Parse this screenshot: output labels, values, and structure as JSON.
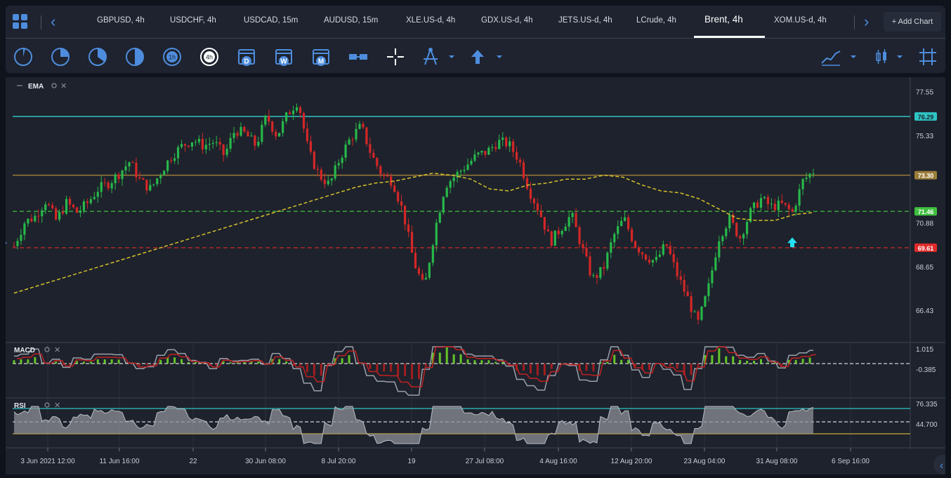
{
  "tabs": [
    {
      "label": "GBPUSD, 4h"
    },
    {
      "label": "USDCHF, 4h"
    },
    {
      "label": "USDCAD, 15m"
    },
    {
      "label": "AUDUSD, 15m"
    },
    {
      "label": "XLE.US-d, 4h"
    },
    {
      "label": "GDX.US-d, 4h"
    },
    {
      "label": "JETS.US-d, 4h"
    },
    {
      "label": "LCrude, 4h"
    },
    {
      "label": "Brent, 4h"
    },
    {
      "label": "XOM.US-d, 4h"
    }
  ],
  "active_tab": "Brent, 4h",
  "add_chart_label": "+ Add Chart",
  "toolbar": {
    "timeframes": [
      {
        "icon": "clock-1m-icon",
        "label": ""
      },
      {
        "icon": "clock-5m-icon",
        "label": ""
      },
      {
        "icon": "clock-15m-icon",
        "label": ""
      },
      {
        "icon": "clock-30m-icon",
        "label": ""
      },
      {
        "icon": "clock-1h-icon",
        "label": "1h"
      },
      {
        "icon": "clock-4h-icon",
        "label": "4h"
      },
      {
        "icon": "calendar-day-icon",
        "label": "D"
      },
      {
        "icon": "calendar-week-icon",
        "label": "W"
      },
      {
        "icon": "calendar-month-icon",
        "label": "M"
      }
    ],
    "accent": "#4e8ddd"
  },
  "indicators": {
    "ema": "EMA",
    "macd": "MACD",
    "rsi": "RSI"
  },
  "chart_data": {
    "type": "candlestick",
    "symbol": "Brent, 4h",
    "price_axis": {
      "ticks": [
        "77.55",
        "75.33",
        "73.30",
        "70.88",
        "68.65",
        "66.43"
      ]
    },
    "horizontal_levels": [
      {
        "label": "76.29",
        "value": 76.29,
        "color": "#2ec4c4",
        "style": "solid"
      },
      {
        "label": "73.30",
        "value": 73.3,
        "color": "#9c7d3a",
        "style": "solid"
      },
      {
        "label": "71.46",
        "value": 71.46,
        "color": "#3fbf3f",
        "style": "dashed"
      },
      {
        "label": "69.61",
        "value": 69.61,
        "color": "#e02b2b",
        "style": "dashed"
      }
    ],
    "ylim": [
      65.0,
      78.0
    ],
    "x_tick_labels": [
      "3 Jun 2021 12:00",
      "11 Jun 16:00",
      "22",
      "30 Jun 08:00",
      "8 Jul 20:00",
      "19",
      "27 Jul 08:00",
      "4 Aug 16:00",
      "12 Aug 20:00",
      "23 Aug 04:00",
      "31 Aug 08:00",
      "6 Sep 16:00"
    ],
    "close_path": [
      69.7,
      70.9,
      71.2,
      72.0,
      71.0,
      71.9,
      71.4,
      71.9,
      72.6,
      72.9,
      73.4,
      74.0,
      73.0,
      72.6,
      73.5,
      74.3,
      74.8,
      75.1,
      74.8,
      75.0,
      74.3,
      75.6,
      75.4,
      74.8,
      76.3,
      75.3,
      76.4,
      77.1,
      74.5,
      73.3,
      72.8,
      74.2,
      75.2,
      75.8,
      74.3,
      73.3,
      73.0,
      71.4,
      68.9,
      67.5,
      70.5,
      72.8,
      73.3,
      73.8,
      74.3,
      74.5,
      75.0,
      74.9,
      74.1,
      72.5,
      71.4,
      69.9,
      70.6,
      71.3,
      69.6,
      68.0,
      68.5,
      70.2,
      71.1,
      69.8,
      69.2,
      68.9,
      69.8,
      68.3,
      67.1,
      65.7,
      67.5,
      70.1,
      71.1,
      70.1,
      71.4,
      72.1,
      71.7,
      71.8,
      71.4,
      73.0,
      73.5
    ],
    "ema_path": [
      67.3,
      67.6,
      67.9,
      68.2,
      68.5,
      68.8,
      69.1,
      69.4,
      69.7,
      70.0,
      70.3,
      70.6,
      70.9,
      71.2,
      71.5,
      71.8,
      72.1,
      72.4,
      72.7,
      72.9,
      73.0,
      73.2,
      73.4,
      73.3,
      73.1,
      72.6,
      72.5,
      72.8,
      72.9,
      73.1,
      73.1,
      73.3,
      73.2,
      72.8,
      72.5,
      72.4,
      72.1,
      71.6,
      71.1,
      71.0,
      71.0,
      71.3,
      71.4
    ],
    "macd": {
      "axis": [
        "1.015",
        "-0.385"
      ]
    },
    "rsi": {
      "axis": [
        "76.335",
        "44.700"
      ]
    },
    "arrow_marker": {
      "color": "#26e0f0"
    }
  }
}
